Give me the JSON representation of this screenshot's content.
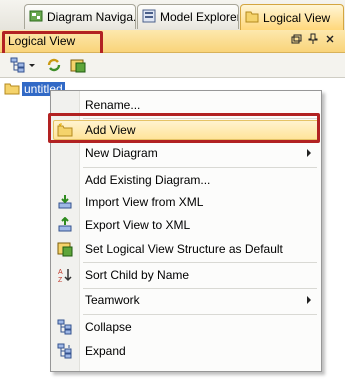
{
  "tabs": [
    {
      "label": "Diagram Naviga...",
      "icon": "diagram-navigator-icon",
      "active": false
    },
    {
      "label": "Model Explorer",
      "icon": "model-explorer-icon",
      "active": false
    },
    {
      "label": "Logical View",
      "icon": "folder-icon",
      "active": true
    }
  ],
  "panel": {
    "title": "Logical View",
    "controls": [
      "restore-icon",
      "pin-icon",
      "close-icon"
    ]
  },
  "toolbar": {
    "buttons": [
      "structure-icon",
      "dropdown-icon",
      "refresh-icon",
      "new-view-icon"
    ]
  },
  "tree": {
    "root_label": "untitled"
  },
  "context_menu": {
    "items": [
      {
        "label": "Rename...",
        "icon": "",
        "submenu": false
      },
      {
        "label": "Add View",
        "icon": "folder-add-icon",
        "submenu": false,
        "selected": true
      },
      {
        "label": "New Diagram",
        "icon": "",
        "submenu": true
      },
      {
        "label": "Add Existing Diagram...",
        "icon": "",
        "submenu": false
      },
      {
        "label": "Import View from XML",
        "icon": "import-icon",
        "submenu": false
      },
      {
        "label": "Export View to XML",
        "icon": "export-icon",
        "submenu": false
      },
      {
        "label": "Set Logical View Structure as Default",
        "icon": "structure-default-icon",
        "submenu": false
      },
      {
        "label": "Sort Child by Name",
        "icon": "sort-icon",
        "submenu": false
      },
      {
        "label": "Teamwork",
        "icon": "",
        "submenu": true
      },
      {
        "label": "Collapse",
        "icon": "collapse-icon",
        "submenu": false
      },
      {
        "label": "Expand",
        "icon": "expand-icon",
        "submenu": false
      }
    ]
  },
  "colors": {
    "highlight_box": "#b22222",
    "selection_blue": "#3169c6",
    "active_tab": "#ffd77a"
  }
}
